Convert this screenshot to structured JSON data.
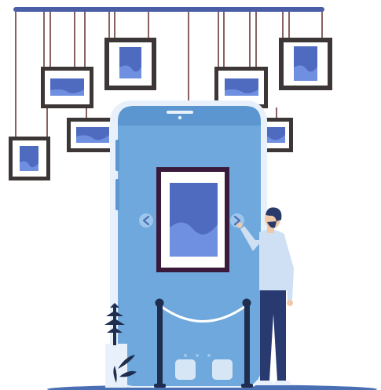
{
  "scene": {
    "subject": "gallery-viewer",
    "colors": {
      "rail": "#4a5ea8",
      "string": "#6b3a3a",
      "frame_dark": "#3c3636",
      "mat": "#ffffff",
      "art_dark": "#4f6bc0",
      "art_light": "#6f8fe0",
      "phone_body": "#6fa8dc",
      "phone_light": "#9ec6ec",
      "phone_bezel": "#e8f1fb",
      "floor": "#4a6fb3",
      "shirt": "#cfe0f5",
      "pants": "#283a70",
      "hair": "#2a3a6a",
      "skin": "#f0c9a8",
      "post": "#1f2d4f",
      "plant": "#1f2d4f",
      "rope": "#ffffff"
    },
    "carousel": {
      "prev_icon": "chevron-left-icon",
      "next_icon": "chevron-right-icon"
    }
  }
}
